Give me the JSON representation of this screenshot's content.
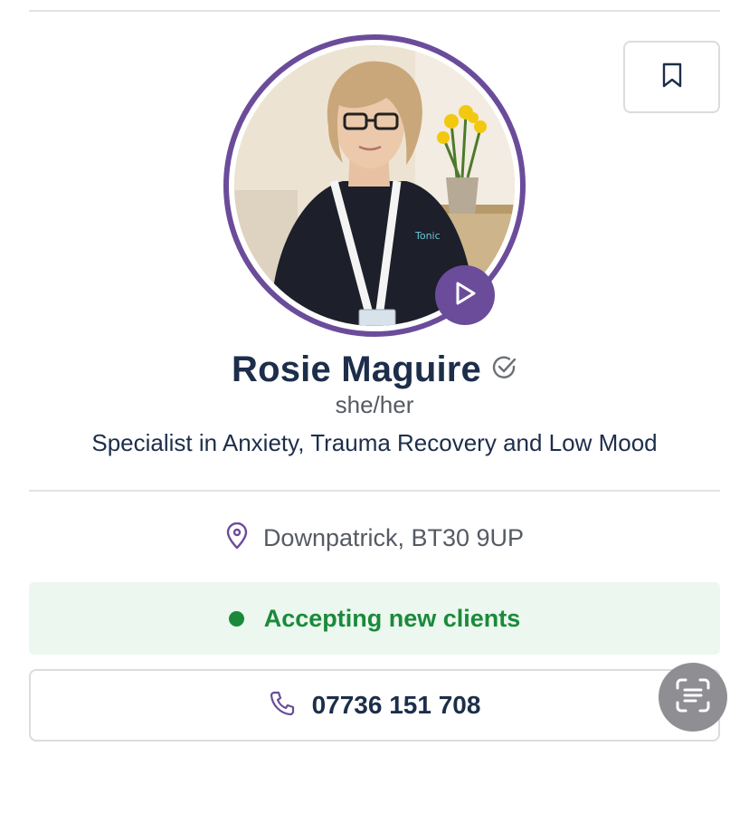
{
  "profile": {
    "name": "Rosie Maguire",
    "pronouns": "she/her",
    "tagline": "Specialist in Anxiety, Trauma Recovery and Low Mood",
    "verified_icon": "check-circle-icon"
  },
  "location": {
    "text": "Downpatrick, BT30 9UP",
    "icon": "map-pin-icon"
  },
  "status": {
    "text": "Accepting new clients",
    "color": "#1a8a3a",
    "background": "#ebf7ef"
  },
  "contact": {
    "phone": "07736 151 708",
    "icon": "phone-icon"
  },
  "icons": {
    "bookmark": "bookmark-icon",
    "play": "play-icon",
    "scan": "scan-text-icon"
  },
  "colors": {
    "accent": "#6b4c9a",
    "heading": "#1d2e4a",
    "muted": "#555a63"
  }
}
